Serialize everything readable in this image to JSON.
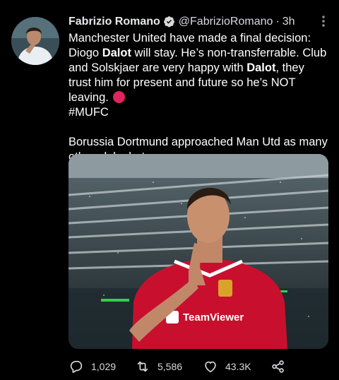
{
  "author": {
    "name": "Fabrizio Romano",
    "handle": "@FabrizioRomano",
    "separator": "·",
    "time": "3h",
    "avatar_icon": "avatar-photo"
  },
  "tweet": {
    "line1_pre": "Manchester United have made a final decision: Diogo ",
    "bold1": "Dalot",
    "line1_post": " will stay. He’s non-transferrable. Club and Solskjaer are very happy with ",
    "bold2": "Dalot",
    "line2_post": ", they trust him for present and future so he’s NOT leaving.",
    "hashtag": "#MUFC",
    "paragraph2": "Borussia Dortmund approached Man Utd as many other clubs but no way."
  },
  "media": {
    "sponsor_text": "TeamViewer",
    "shirt_color": "#c8102e",
    "icon": "photo-player"
  },
  "actions": {
    "replies": "1,029",
    "retweets": "5,586",
    "likes": "43.3K",
    "reply_icon": "reply-icon",
    "retweet_icon": "retweet-icon",
    "like_icon": "heart-icon",
    "share_icon": "share-icon"
  },
  "colors": {
    "background": "#000000",
    "text": "#e7e9ea",
    "verified": "#d9d9d9",
    "red_circle": "#e0245e"
  }
}
